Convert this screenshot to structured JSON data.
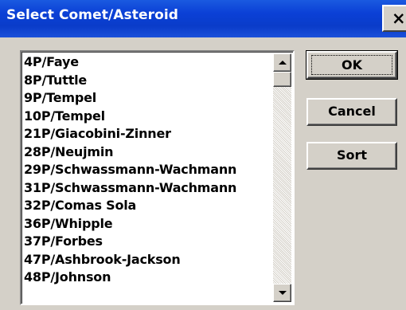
{
  "window": {
    "title": "Select Comet/Asteroid",
    "close_glyph": "×"
  },
  "list": {
    "items": [
      "4P/Faye",
      "8P/Tuttle",
      "9P/Tempel",
      "10P/Tempel",
      "21P/Giacobini-Zinner",
      "28P/Neujmin",
      "29P/Schwassmann-Wachmann",
      "31P/Schwassmann-Wachmann",
      "32P/Comas Sola",
      "36P/Whipple",
      "37P/Forbes",
      "47P/Ashbrook-Jackson",
      "48P/Johnson"
    ]
  },
  "buttons": {
    "ok": "OK",
    "cancel": "Cancel",
    "sort": "Sort"
  },
  "colors": {
    "titlebar": "#0a3cc9",
    "dialog_face": "#d4d0c8",
    "list_background": "#ffffff"
  }
}
